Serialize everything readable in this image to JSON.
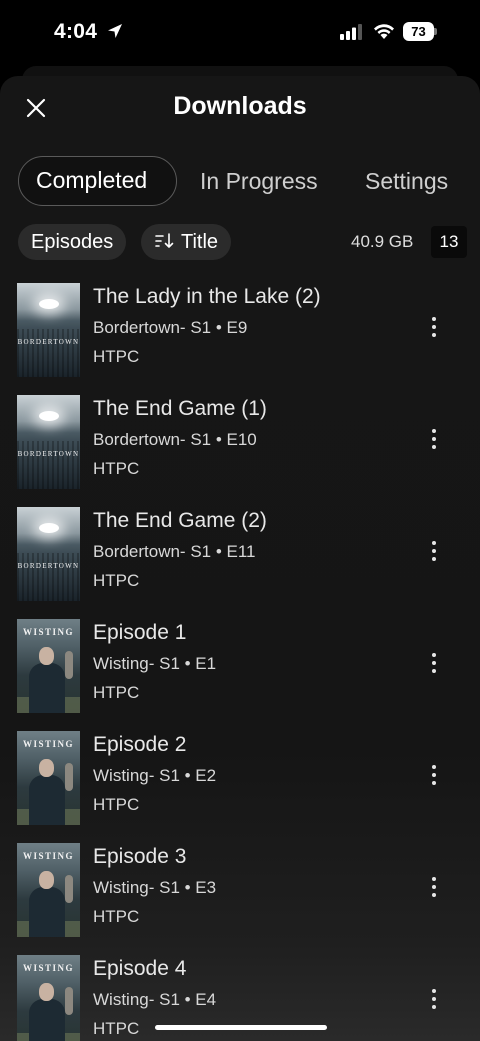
{
  "status_bar": {
    "time": "4:04",
    "battery": "73"
  },
  "header": {
    "title": "Downloads"
  },
  "tabs": [
    {
      "label": "Completed"
    },
    {
      "label": "In Progress"
    },
    {
      "label": "Settings"
    }
  ],
  "filters": {
    "type_label": "Episodes",
    "sort_label": "Title",
    "storage": "40.9 GB",
    "count": "13"
  },
  "items": [
    {
      "title": "The Lady in the Lake (2)",
      "subtitle": "Bordertown- S1 • E9",
      "server": "HTPC",
      "poster_label": "BORDERTOWN"
    },
    {
      "title": "The End Game (1)",
      "subtitle": "Bordertown- S1 • E10",
      "server": "HTPC",
      "poster_label": "BORDERTOWN"
    },
    {
      "title": "The End Game (2)",
      "subtitle": "Bordertown- S1 • E11",
      "server": "HTPC",
      "poster_label": "BORDERTOWN"
    },
    {
      "title": "Episode 1",
      "subtitle": "Wisting- S1 • E1",
      "server": "HTPC",
      "poster_label": "WISTING"
    },
    {
      "title": "Episode 2",
      "subtitle": "Wisting- S1 • E2",
      "server": "HTPC",
      "poster_label": "WISTING"
    },
    {
      "title": "Episode 3",
      "subtitle": "Wisting- S1 • E3",
      "server": "HTPC",
      "poster_label": "WISTING"
    },
    {
      "title": "Episode 4",
      "subtitle": "Wisting- S1 • E4",
      "server": "HTPC",
      "poster_label": "WISTING"
    }
  ]
}
